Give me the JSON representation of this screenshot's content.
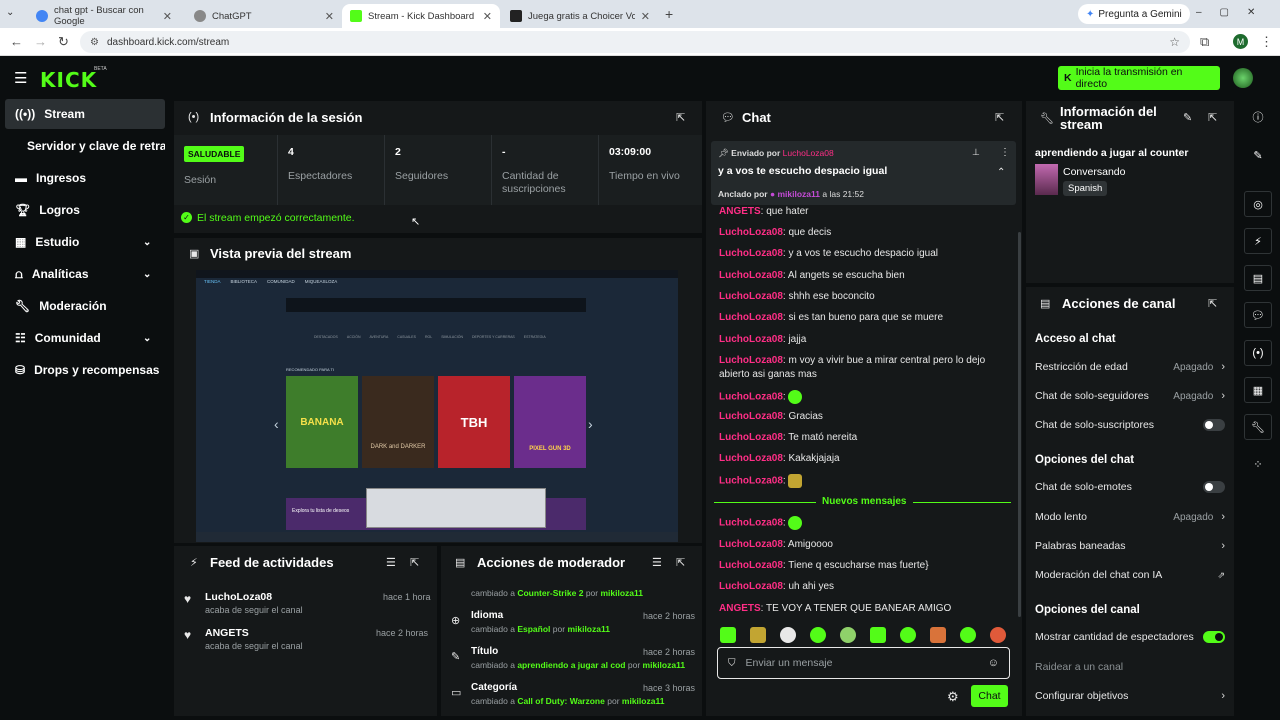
{
  "browser": {
    "tabs": [
      {
        "label": "chat gpt - Buscar con Google",
        "fav": "#4285f4"
      },
      {
        "label": "ChatGPT",
        "fav": "#888"
      },
      {
        "label": "Stream - Kick Dashboard",
        "fav": "#53fc18"
      },
      {
        "label": "Juega gratis a Choicer Voicer o",
        "fav": "#222"
      }
    ],
    "gemini": "Pregunta a Gemini",
    "url": "dashboard.kick.com/stream",
    "profile": "M"
  },
  "header": {
    "logo": "KICK",
    "beta": "BETA",
    "golive": "Inicia la transmisión en directo"
  },
  "sidebar": {
    "items": [
      {
        "label": "Stream"
      },
      {
        "label": "Servidor y clave de retransm"
      },
      {
        "label": "Ingresos"
      },
      {
        "label": "Logros"
      },
      {
        "label": "Estudio"
      },
      {
        "label": "Analíticas"
      },
      {
        "label": "Moderación"
      },
      {
        "label": "Comunidad"
      },
      {
        "label": "Drops y recompensas"
      }
    ]
  },
  "session": {
    "title": "Información de la sesión",
    "badge": "SALUDABLE",
    "session_label": "Sesión",
    "stats": [
      {
        "value": "4",
        "label": "Espectadores"
      },
      {
        "value": "2",
        "label": "Seguidores"
      },
      {
        "value": "-",
        "label": "Cantidad de suscripciones"
      },
      {
        "value": "03:09:00",
        "label": "Tiempo en vivo"
      }
    ],
    "status": "El stream empezó correctamente."
  },
  "preview": {
    "title": "Vista previa del stream",
    "nav": [
      "TIENDA",
      "BIBLIOTECA",
      "COMUNIDAD",
      "MIQUEASLOZA"
    ],
    "cats": [
      "DESTACADOS",
      "ACCIÓN",
      "AVENTURA",
      "CASUALES",
      "ROL",
      "SIMULACIÓN",
      "DEPORTES Y CARRERAS",
      "ESTRATEGIA"
    ],
    "section": "RECOMENDADO PARA TI",
    "games": [
      "BANANA",
      "DARK and DARKER",
      "TBH",
      "PIXEL GUN 3D"
    ],
    "explore": "Explora tu lista de deseos"
  },
  "activity": {
    "title": "Feed de actividades",
    "items": [
      {
        "user": "LuchoLoza08",
        "time": "hace 1 hora",
        "desc": "acaba de seguir el canal"
      },
      {
        "user": "ANGETS",
        "time": "hace 2 horas",
        "desc": "acaba de seguir el canal"
      }
    ]
  },
  "modactions": {
    "title": "Acciones de moderador",
    "items": [
      {
        "title": "",
        "time": "",
        "pre": "cambiado a",
        "value": "Counter-Strike 2",
        "by": "por",
        "user": "mikiloza11"
      },
      {
        "title": "Idioma",
        "time": "hace 2 horas",
        "pre": "cambiado a",
        "value": "Español",
        "by": "por",
        "user": "mikiloza11"
      },
      {
        "title": "Título",
        "time": "hace 2 horas",
        "pre": "cambiado a",
        "value": "aprendiendo a jugar al cod",
        "by": "por",
        "user": "mikiloza11"
      },
      {
        "title": "Categoría",
        "time": "hace 3 horas",
        "pre": "cambiado a",
        "value": "Call of Duty: Warzone",
        "by": "por",
        "user": "mikiloza11"
      }
    ]
  },
  "chat": {
    "title": "Chat",
    "pinned": {
      "sent_by": "Enviado por",
      "sent_user": "LuchoLoza08",
      "text": "y a vos te escucho despacio igual",
      "pinned_by": "Anclado por",
      "pin_user": "mikiloza11",
      "pin_time": "a las 21:52"
    },
    "messages": [
      {
        "user": "ANGETS",
        "text": ": que hater"
      },
      {
        "user": "LuchoLoza08",
        "text": ": que decis"
      },
      {
        "user": "LuchoLoza08",
        "text": ": y a vos te escucho despacio igual"
      },
      {
        "user": "LuchoLoza08",
        "text": ": Al angets se escucha bien"
      },
      {
        "user": "LuchoLoza08",
        "text": ": shhh ese boconcito"
      },
      {
        "user": "LuchoLoza08",
        "text": ": si es tan bueno para que se muere"
      },
      {
        "user": "LuchoLoza08",
        "text": ": jajja"
      },
      {
        "user": "LuchoLoza08",
        "text": ": m voy a vivir bue a mirar central pero lo dejo abierto asi ganas mas"
      },
      {
        "user": "LuchoLoza08",
        "text": ":"
      },
      {
        "user": "LuchoLoza08",
        "text": ": Gracias"
      },
      {
        "user": "LuchoLoza08",
        "text": ": Te mató nereita"
      },
      {
        "user": "LuchoLoza08",
        "text": ": Kakakjajaja"
      },
      {
        "user": "LuchoLoza08",
        "text": ":"
      }
    ],
    "new_label": "Nuevos mensajes",
    "new_messages": [
      {
        "user": "LuchoLoza08",
        "text": ":"
      },
      {
        "user": "LuchoLoza08",
        "text": ": Amigoooo"
      },
      {
        "user": "LuchoLoza08",
        "text": ": Tiene q escucharse mas fuerte}"
      },
      {
        "user": "LuchoLoza08",
        "text": ": uh ahi yes"
      },
      {
        "user": "ANGETS",
        "text": ": TE VOY A TENER QUE BANEAR AMIGO"
      }
    ],
    "placeholder": "Enviar un mensaje",
    "send": "Chat"
  },
  "streaminfo": {
    "title": "Información del stream",
    "stream_title": "aprendiendo a jugar al counter",
    "category": "Conversando",
    "language": "Spanish"
  },
  "channel": {
    "title": "Acciones de canal",
    "sections": {
      "chat_access": "Acceso al chat",
      "chat_options": "Opciones del chat",
      "channel_options": "Opciones del canal"
    },
    "age": {
      "label": "Restricción de edad",
      "state": "Apagado"
    },
    "followers": {
      "label": "Chat de solo-seguidores",
      "state": "Apagado"
    },
    "subs": {
      "label": "Chat de solo-suscriptores"
    },
    "emotes": {
      "label": "Chat de solo-emotes"
    },
    "slow": {
      "label": "Modo lento",
      "state": "Apagado"
    },
    "banned": {
      "label": "Palabras baneadas"
    },
    "ai": {
      "label": "Moderación del chat con IA"
    },
    "viewers": {
      "label": "Mostrar cantidad de espectadores"
    },
    "raid": {
      "label": "Raidear a un canal"
    },
    "goals": {
      "label": "Configurar objetivos"
    }
  },
  "colors": {
    "accent": "#53fc18",
    "username": "#ff2e86",
    "panel": "#151819",
    "bg": "#0b0e0f"
  }
}
